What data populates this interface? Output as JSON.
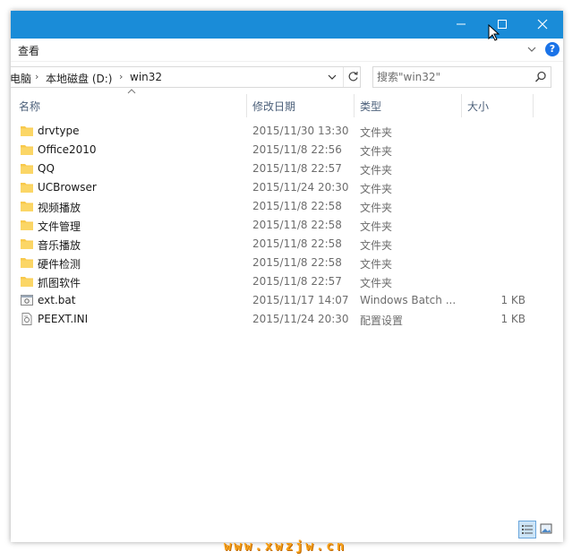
{
  "window": {
    "ribbon_tab": "查看",
    "help_label": "?"
  },
  "address": {
    "crumbs": [
      "电脑",
      "本地磁盘 (D:)",
      "win32"
    ],
    "separator": "›"
  },
  "search": {
    "placeholder": "搜索\"win32\""
  },
  "columns": {
    "name": "名称",
    "date": "修改日期",
    "type": "类型",
    "size": "大小"
  },
  "files": [
    {
      "name": "drvtype",
      "date": "2015/11/30 13:30",
      "type": "文件夹",
      "size": "",
      "icon": "folder-icon"
    },
    {
      "name": "Office2010",
      "date": "2015/11/8 22:56",
      "type": "文件夹",
      "size": "",
      "icon": "folder-icon"
    },
    {
      "name": "QQ",
      "date": "2015/11/8 22:57",
      "type": "文件夹",
      "size": "",
      "icon": "folder-icon"
    },
    {
      "name": "UCBrowser",
      "date": "2015/11/24 20:30",
      "type": "文件夹",
      "size": "",
      "icon": "folder-icon"
    },
    {
      "name": "视频播放",
      "date": "2015/11/8 22:58",
      "type": "文件夹",
      "size": "",
      "icon": "folder-icon"
    },
    {
      "name": "文件管理",
      "date": "2015/11/8 22:58",
      "type": "文件夹",
      "size": "",
      "icon": "folder-icon"
    },
    {
      "name": "音乐播放",
      "date": "2015/11/8 22:58",
      "type": "文件夹",
      "size": "",
      "icon": "folder-icon"
    },
    {
      "name": "硬件检测",
      "date": "2015/11/8 22:58",
      "type": "文件夹",
      "size": "",
      "icon": "folder-icon"
    },
    {
      "name": "抓图软件",
      "date": "2015/11/8 22:57",
      "type": "文件夹",
      "size": "",
      "icon": "folder-icon"
    },
    {
      "name": "ext.bat",
      "date": "2015/11/17 14:07",
      "type": "Windows Batch ...",
      "size": "1 KB",
      "icon": "batch-file-icon"
    },
    {
      "name": "PEEXT.INI",
      "date": "2015/11/24 20:30",
      "type": "配置设置",
      "size": "1 KB",
      "icon": "ini-file-icon"
    }
  ],
  "watermark": "www.xwzjw.cn",
  "colors": {
    "titlebar": "#1a8cd8",
    "folder": "#f8c94c",
    "accent": "#1a73e8"
  }
}
